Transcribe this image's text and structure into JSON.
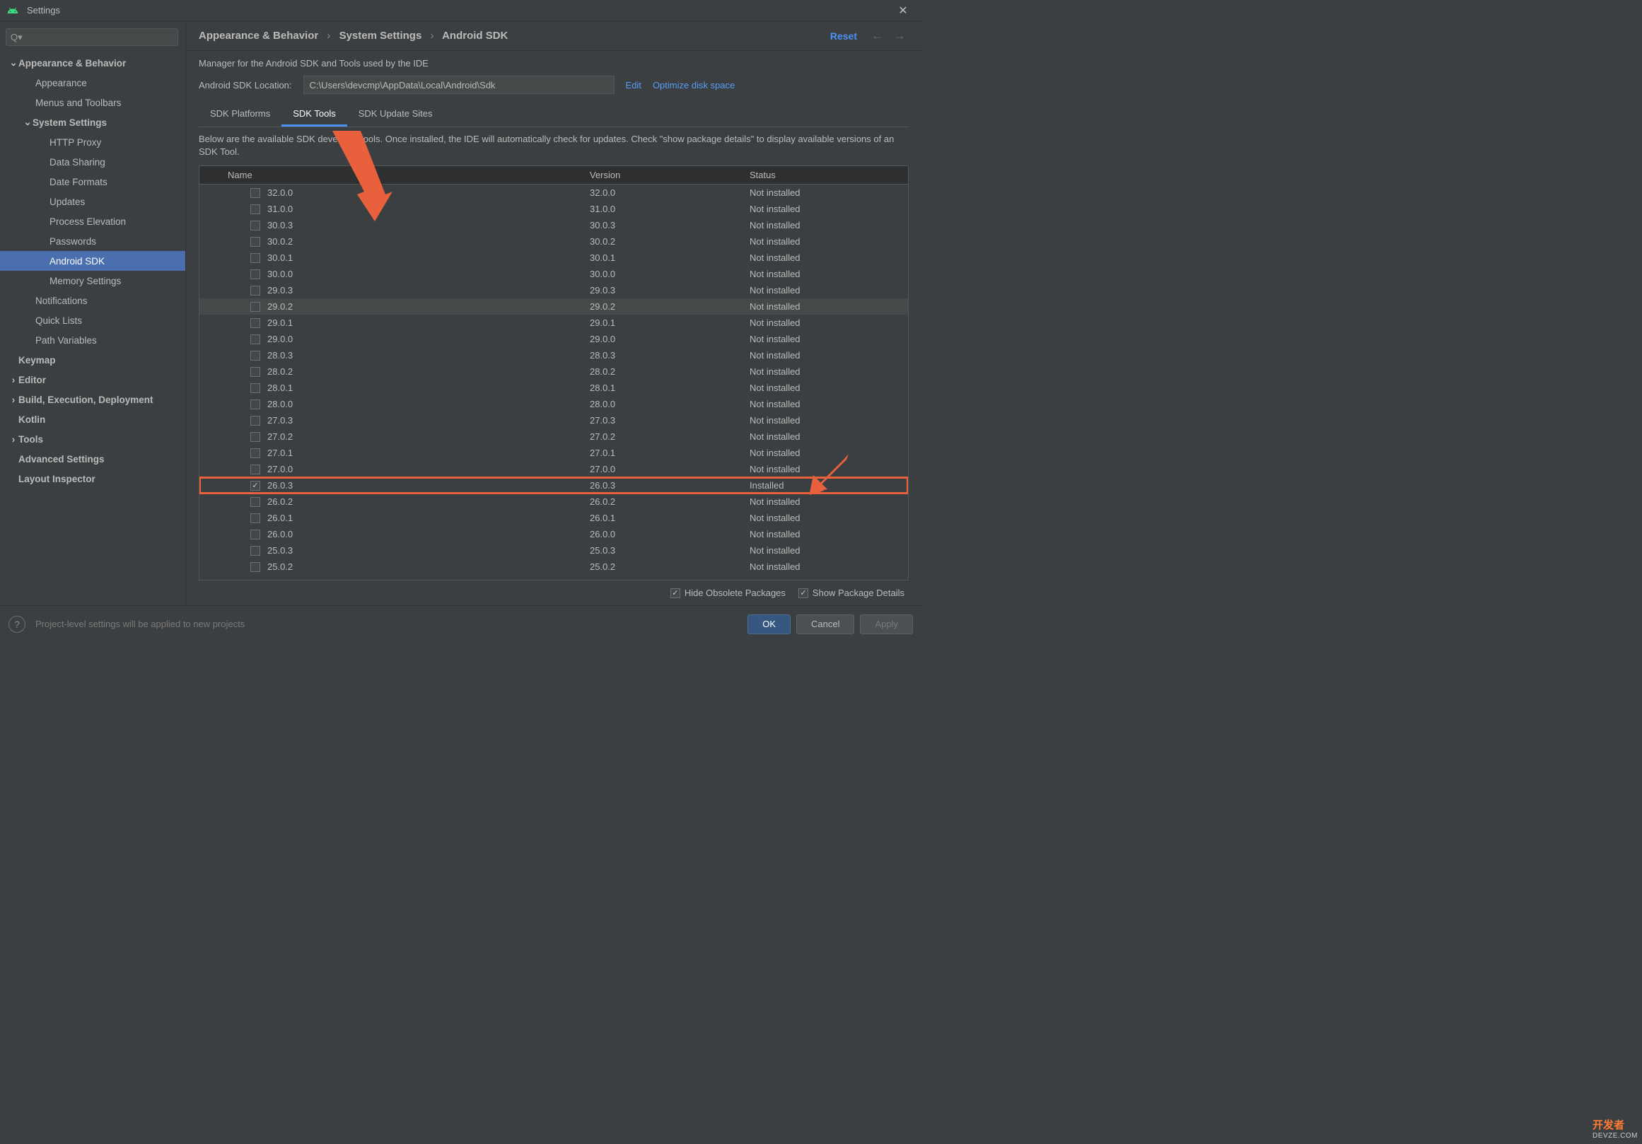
{
  "window": {
    "title": "Settings"
  },
  "sidebar": {
    "search_placeholder": "",
    "items": [
      {
        "label": "Appearance & Behavior",
        "bold": true,
        "chevron": "down",
        "indent": 0
      },
      {
        "label": "Appearance",
        "indent": 1
      },
      {
        "label": "Menus and Toolbars",
        "indent": 1
      },
      {
        "label": "System Settings",
        "bold": true,
        "chevron": "down",
        "indent": 1,
        "sub": true
      },
      {
        "label": "HTTP Proxy",
        "indent": 2
      },
      {
        "label": "Data Sharing",
        "indent": 2
      },
      {
        "label": "Date Formats",
        "indent": 2
      },
      {
        "label": "Updates",
        "indent": 2
      },
      {
        "label": "Process Elevation",
        "indent": 2
      },
      {
        "label": "Passwords",
        "indent": 2
      },
      {
        "label": "Android SDK",
        "indent": 2,
        "selected": true
      },
      {
        "label": "Memory Settings",
        "indent": 2
      },
      {
        "label": "Notifications",
        "indent": 1
      },
      {
        "label": "Quick Lists",
        "indent": 1
      },
      {
        "label": "Path Variables",
        "indent": 1
      },
      {
        "label": "Keymap",
        "bold": true,
        "indent": 0,
        "nochev": true
      },
      {
        "label": "Editor",
        "bold": true,
        "chevron": "right",
        "indent": 0
      },
      {
        "label": "Build, Execution, Deployment",
        "bold": true,
        "chevron": "right",
        "indent": 0
      },
      {
        "label": "Kotlin",
        "bold": true,
        "indent": 0,
        "nochev": true
      },
      {
        "label": "Tools",
        "bold": true,
        "chevron": "right",
        "indent": 0
      },
      {
        "label": "Advanced Settings",
        "bold": true,
        "indent": 0,
        "nochev": true
      },
      {
        "label": "Layout Inspector",
        "bold": true,
        "indent": 0,
        "nochev": true
      }
    ]
  },
  "breadcrumb": {
    "part1": "Appearance & Behavior",
    "part2": "System Settings",
    "part3": "Android SDK",
    "reset": "Reset"
  },
  "manager_text": "Manager for the Android SDK and Tools used by the IDE",
  "sdk_location": {
    "label": "Android SDK Location:",
    "value": "C:\\Users\\devcmp\\AppData\\Local\\Android\\Sdk",
    "edit": "Edit",
    "optimize": "Optimize disk space"
  },
  "tabs": [
    {
      "label": "SDK Platforms",
      "active": false
    },
    {
      "label": "SDK Tools",
      "active": true
    },
    {
      "label": "SDK Update Sites",
      "active": false
    }
  ],
  "tab_desc": "Below are the available SDK developer tools. Once installed, the IDE will automatically check for updates. Check \"show package details\" to display available versions of an SDK Tool.",
  "table": {
    "headers": {
      "name": "Name",
      "version": "Version",
      "status": "Status"
    },
    "rows": [
      {
        "name": "32.0.0",
        "version": "32.0.0",
        "status": "Not installed",
        "checked": false
      },
      {
        "name": "31.0.0",
        "version": "31.0.0",
        "status": "Not installed",
        "checked": false
      },
      {
        "name": "30.0.3",
        "version": "30.0.3",
        "status": "Not installed",
        "checked": false
      },
      {
        "name": "30.0.2",
        "version": "30.0.2",
        "status": "Not installed",
        "checked": false
      },
      {
        "name": "30.0.1",
        "version": "30.0.1",
        "status": "Not installed",
        "checked": false
      },
      {
        "name": "30.0.0",
        "version": "30.0.0",
        "status": "Not installed",
        "checked": false
      },
      {
        "name": "29.0.3",
        "version": "29.0.3",
        "status": "Not installed",
        "checked": false
      },
      {
        "name": "29.0.2",
        "version": "29.0.2",
        "status": "Not installed",
        "checked": false,
        "hover": true
      },
      {
        "name": "29.0.1",
        "version": "29.0.1",
        "status": "Not installed",
        "checked": false
      },
      {
        "name": "29.0.0",
        "version": "29.0.0",
        "status": "Not installed",
        "checked": false
      },
      {
        "name": "28.0.3",
        "version": "28.0.3",
        "status": "Not installed",
        "checked": false
      },
      {
        "name": "28.0.2",
        "version": "28.0.2",
        "status": "Not installed",
        "checked": false
      },
      {
        "name": "28.0.1",
        "version": "28.0.1",
        "status": "Not installed",
        "checked": false
      },
      {
        "name": "28.0.0",
        "version": "28.0.0",
        "status": "Not installed",
        "checked": false
      },
      {
        "name": "27.0.3",
        "version": "27.0.3",
        "status": "Not installed",
        "checked": false
      },
      {
        "name": "27.0.2",
        "version": "27.0.2",
        "status": "Not installed",
        "checked": false
      },
      {
        "name": "27.0.1",
        "version": "27.0.1",
        "status": "Not installed",
        "checked": false
      },
      {
        "name": "27.0.0",
        "version": "27.0.0",
        "status": "Not installed",
        "checked": false
      },
      {
        "name": "26.0.3",
        "version": "26.0.3",
        "status": "Installed",
        "checked": true,
        "highlighted": true
      },
      {
        "name": "26.0.2",
        "version": "26.0.2",
        "status": "Not installed",
        "checked": false
      },
      {
        "name": "26.0.1",
        "version": "26.0.1",
        "status": "Not installed",
        "checked": false
      },
      {
        "name": "26.0.0",
        "version": "26.0.0",
        "status": "Not installed",
        "checked": false
      },
      {
        "name": "25.0.3",
        "version": "25.0.3",
        "status": "Not installed",
        "checked": false
      },
      {
        "name": "25.0.2",
        "version": "25.0.2",
        "status": "Not installed",
        "checked": false
      }
    ]
  },
  "bottom_options": {
    "hide_obsolete": "Hide Obsolete Packages",
    "show_details": "Show Package Details"
  },
  "footer": {
    "help_hint": "Project-level settings will be applied to new projects",
    "ok": "OK",
    "cancel": "Cancel",
    "apply": "Apply"
  },
  "watermark": {
    "main": "开发者",
    "sub": "DEVZE.COM"
  }
}
